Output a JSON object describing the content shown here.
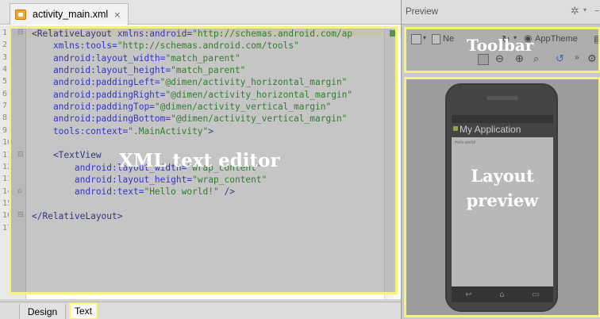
{
  "editor": {
    "tab_title": "activity_main.xml",
    "tab_close": "×",
    "line_numbers": [
      "1",
      "2",
      "3",
      "4",
      "5",
      "6",
      "7",
      "8",
      "9",
      "10",
      "11",
      "12",
      "13",
      "14",
      "15",
      "16",
      "17"
    ],
    "code_lines": [
      [
        {
          "t": "tag",
          "v": "<RelativeLayout "
        },
        {
          "t": "attr",
          "v": "xmlns:android="
        },
        {
          "t": "val",
          "v": "\"http://schemas.android.com/ap"
        }
      ],
      [
        {
          "t": "attr",
          "v": "    xmlns:tools="
        },
        {
          "t": "val",
          "v": "\"http://schemas.android.com/tools\""
        }
      ],
      [
        {
          "t": "attr",
          "v": "    android:layout_width="
        },
        {
          "t": "val",
          "v": "\"match_parent\""
        }
      ],
      [
        {
          "t": "attr",
          "v": "    android:layout_height="
        },
        {
          "t": "val",
          "v": "\"match_parent\""
        }
      ],
      [
        {
          "t": "attr",
          "v": "    android:paddingLeft="
        },
        {
          "t": "val",
          "v": "\"@dimen/activity_horizontal_margin\""
        }
      ],
      [
        {
          "t": "attr",
          "v": "    android:paddingRight="
        },
        {
          "t": "val",
          "v": "\"@dimen/activity_horizontal_margin\""
        }
      ],
      [
        {
          "t": "attr",
          "v": "    android:paddingTop="
        },
        {
          "t": "val",
          "v": "\"@dimen/activity_vertical_margin\""
        }
      ],
      [
        {
          "t": "attr",
          "v": "    android:paddingBottom="
        },
        {
          "t": "val",
          "v": "\"@dimen/activity_vertical_margin\""
        }
      ],
      [
        {
          "t": "attr",
          "v": "    tools:context="
        },
        {
          "t": "val",
          "v": "\".MainActivity\""
        },
        {
          "t": "tag",
          "v": ">"
        }
      ],
      [],
      [
        {
          "t": "tag",
          "v": "    <TextView"
        }
      ],
      [
        {
          "t": "attr",
          "v": "        android:layout_width="
        },
        {
          "t": "val",
          "v": "\"wrap_content\""
        }
      ],
      [
        {
          "t": "attr",
          "v": "        android:layout_height="
        },
        {
          "t": "val",
          "v": "\"wrap_content\""
        }
      ],
      [
        {
          "t": "attr",
          "v": "        android:text="
        },
        {
          "t": "val",
          "v": "\"Hello world!\""
        },
        {
          "t": "tag",
          "v": " />"
        }
      ],
      [],
      [
        {
          "t": "tag",
          "v": "</RelativeLayout>"
        }
      ],
      []
    ],
    "overlay_caption": "XML text editor"
  },
  "bottom_tabs": {
    "design": "Design",
    "text": "Text"
  },
  "preview": {
    "title": "Preview",
    "toolbar": {
      "device_label": "Ne",
      "theme_label": "AppTheme",
      "caption": "Toolbar"
    },
    "phone": {
      "app_title": "My Application",
      "hello_text": "Hello world!"
    },
    "caption_line1": "Layout",
    "caption_line2": "preview"
  },
  "colors": {
    "highlight_border": "#f4f47a",
    "xml_tag": "#000080",
    "xml_attr": "#0000ff",
    "xml_value": "#008000"
  }
}
